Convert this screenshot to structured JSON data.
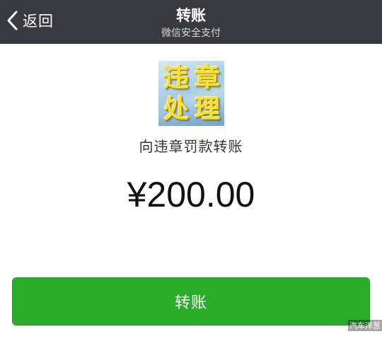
{
  "header": {
    "back_label": "返回",
    "title": "转账",
    "subtitle": "微信安全支付"
  },
  "payee": {
    "logo_chars": [
      "违",
      "章",
      "处",
      "理"
    ],
    "description": "向违章罚款转账"
  },
  "amount": "¥200.00",
  "actions": {
    "transfer_label": "转账"
  },
  "watermark": "汽车洋葱"
}
